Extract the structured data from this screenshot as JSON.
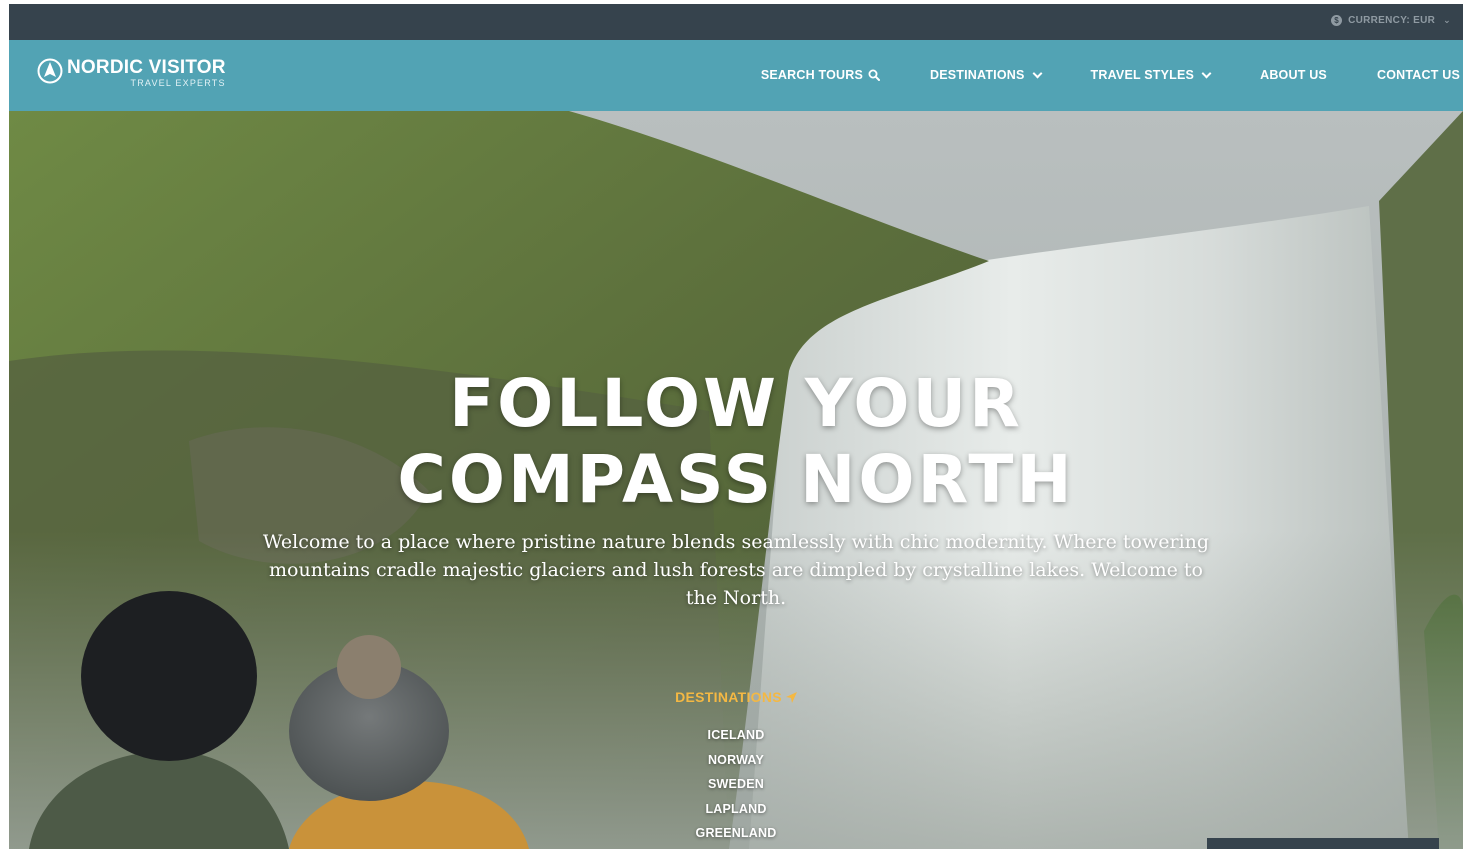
{
  "topbar": {
    "currency_icon": "coin-icon",
    "currency_label": "CURRENCY: EUR",
    "currency_chevron": "⌄"
  },
  "brand": {
    "name": "NORDIC VISITOR",
    "tagline": "TRAVEL EXPERTS",
    "icon": "compass-icon"
  },
  "nav": {
    "search_tours": "SEARCH TOURS",
    "destinations": "DESTINATIONS",
    "travel_styles": "TRAVEL STYLES",
    "about_us": "ABOUT US",
    "contact_us": "CONTACT US"
  },
  "hero": {
    "headline_line1": "FOLLOW YOUR",
    "headline_line2": "COMPASS NORTH",
    "tagline": "Welcome to a place where pristine nature blends seamlessly with chic modernity. Where towering mountains cradle majestic glaciers and lush forests are dimpled by crystalline lakes. Welcome to the North.",
    "destinations_title": "DESTINATIONS",
    "destinations": [
      "ICELAND",
      "NORWAY",
      "SWEDEN",
      "LAPLAND",
      "GREENLAND"
    ]
  },
  "colors": {
    "topbar_bg": "#36434d",
    "nav_bg": "#52a3b4",
    "accent": "#f4b843"
  }
}
